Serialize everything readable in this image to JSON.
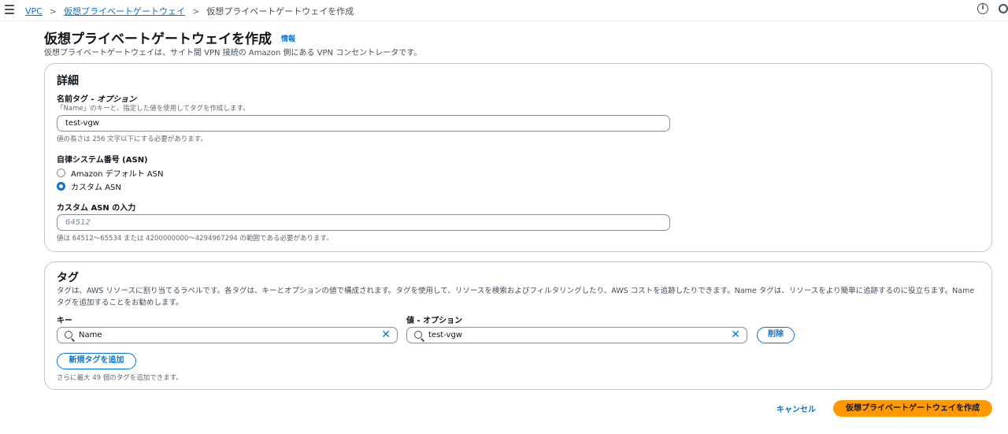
{
  "breadcrumb": {
    "items": [
      "VPC",
      "仮想プライベートゲートウェイ"
    ],
    "current": "仮想プライベートゲートウェイを作成"
  },
  "header": {
    "title": "仮想プライベートゲートウェイを作成",
    "info": "情報",
    "description": "仮想プライベートゲートウェイは、サイト間 VPN 接続の Amazon 側にある VPN コンセントレータです。"
  },
  "details": {
    "title": "詳細",
    "name_tag": {
      "label_main": "名前タグ - ",
      "label_opt": "オプション",
      "hint": "「Name」のキーと、指定した値を使用してタグを作成します。",
      "value": "test-vgw",
      "constraint": "値の長さは 256 文字以下にする必要があります。"
    },
    "asn": {
      "label": "自律システム番号 (ASN)",
      "options": [
        {
          "label": "Amazon デフォルト ASN",
          "selected": false
        },
        {
          "label": "カスタム ASN",
          "selected": true
        }
      ]
    },
    "custom_asn": {
      "label": "カスタム ASN の入力",
      "placeholder": "64512",
      "constraint": "値は 64512〜65534 または 4200000000〜4294967294 の範囲である必要があります。"
    }
  },
  "tags": {
    "title": "タグ",
    "description": "タグは、AWS リソースに割り当てるラベルです。各タグは、キーとオプションの値で構成されます。タグを使用して、リソースを検索およびフィルタリングしたり、AWS コストを追跡したりできます。Name タグは、リソースをより簡単に追跡するのに役立ちます。Name タグを追加することをお勧めします。",
    "key_label": "キー",
    "value_label": "値 - オプション",
    "key_value": "Name",
    "tag_value": "test-vgw",
    "remove_label": "削除",
    "add_label": "新規タグを追加",
    "limit_hint": "さらに最大 49 個のタグを追加できます。"
  },
  "footer": {
    "cancel": "キャンセル",
    "submit": "仮想プライベートゲートウェイを作成"
  }
}
